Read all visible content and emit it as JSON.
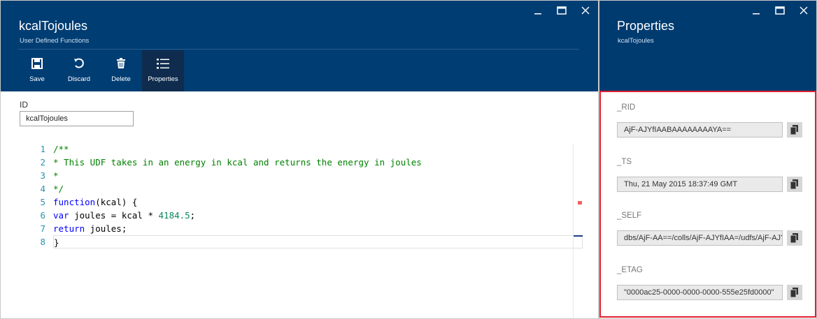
{
  "left_blade": {
    "title": "kcalTojoules",
    "subtitle": "User Defined Functions",
    "toolbar": [
      {
        "label": "Save",
        "icon": "save-icon"
      },
      {
        "label": "Discard",
        "icon": "undo-icon"
      },
      {
        "label": "Delete",
        "icon": "trash-icon"
      },
      {
        "label": "Properties",
        "icon": "list-icon"
      }
    ],
    "id_label": "ID",
    "id_value": "kcalTojoules",
    "code_lines": [
      {
        "n": "1",
        "text": "/**"
      },
      {
        "n": "2",
        "text": "* This UDF takes in an energy in kcal and returns the energy in joules"
      },
      {
        "n": "3",
        "text": "*"
      },
      {
        "n": "4",
        "text": "*/"
      },
      {
        "n": "5",
        "kw": "function",
        "rest": "(kcal) {"
      },
      {
        "n": "6",
        "kw": "var",
        "rest": " joules = kcal * ",
        "num": "4184.5",
        "tail": ";"
      },
      {
        "n": "7",
        "kw": "return",
        "rest": " joules;"
      },
      {
        "n": "8",
        "text": "}"
      }
    ]
  },
  "right_blade": {
    "title": "Properties",
    "subtitle": "kcalTojoules",
    "properties": [
      {
        "label": "_RID",
        "value": "AjF-AJYfIAABAAAAAAAAYA=="
      },
      {
        "label": "_TS",
        "value": "Thu, 21 May 2015 18:37:49 GMT"
      },
      {
        "label": "_SELF",
        "value": "dbs/AjF-AA==/colls/AjF-AJYfIAA=/udfs/AjF-AJYfIAABAAAAAAAAYA==/"
      },
      {
        "label": "_ETAG",
        "value": "\"0000ac25-0000-0000-0000-555e25fd0000\""
      }
    ]
  },
  "colors": {
    "header_bg": "#003d73",
    "highlight_border": "#e02030"
  }
}
